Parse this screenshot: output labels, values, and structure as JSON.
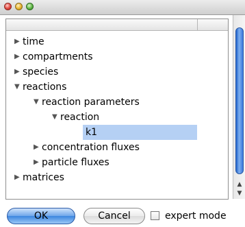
{
  "tree": {
    "items": [
      {
        "label": "time",
        "expanded": false
      },
      {
        "label": "compartments",
        "expanded": false
      },
      {
        "label": "species",
        "expanded": false
      },
      {
        "label": "reactions",
        "expanded": true
      },
      {
        "label": "reaction parameters",
        "expanded": true
      },
      {
        "label": "reaction",
        "expanded": true
      },
      {
        "label": "k1",
        "selected": true
      },
      {
        "label": "concentration fluxes",
        "expanded": false
      },
      {
        "label": "particle fluxes",
        "expanded": false
      },
      {
        "label": "matrices",
        "expanded": false
      }
    ]
  },
  "buttons": {
    "ok": "OK",
    "cancel": "Cancel"
  },
  "checkbox": {
    "label": "expert mode",
    "checked": false
  },
  "icons": {
    "collapsed": "▶",
    "expanded": "▼",
    "scroll_up": "▲",
    "scroll_down": "▼"
  }
}
